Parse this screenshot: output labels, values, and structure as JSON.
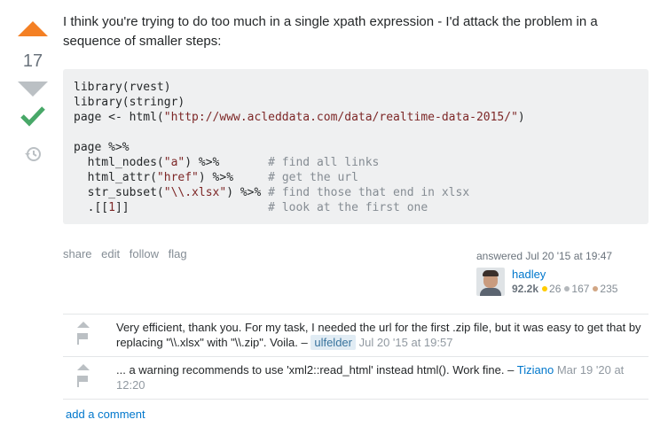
{
  "vote": {
    "score": "17",
    "accepted": true
  },
  "answer": {
    "intro": "I think you're trying to do too much in a single xpath expression - I'd attack the problem in a sequence of smaller steps:",
    "code_lines": [
      "library(rvest)",
      "library(stringr)",
      "page <- html(\"http://www.acleddata.com/data/realtime-data-2015/\")",
      "",
      "page %>%",
      "  html_nodes(\"a\") %>%       # find all links",
      "  html_attr(\"href\") %>%     # get the url",
      "  str_subset(\"\\\\.xlsx\") %>% # find those that end in xlsx",
      "  .[[1]]                    # look at the first one"
    ]
  },
  "post_menu": {
    "share": "share",
    "edit": "edit",
    "follow": "follow",
    "flag": "flag"
  },
  "signature": {
    "action": "answered Jul 20 '15 at 19:47",
    "user": "hadley",
    "reputation": "92.2k",
    "gold": "26",
    "silver": "167",
    "bronze": "235"
  },
  "comments": [
    {
      "text": "Very efficient, thank you. For my task, I needed the url for the first .zip file, but it was easy to get that by replacing \"\\\\.xlsx\" with \"\\\\.zip\". Voila. –",
      "user": "ulfelder",
      "date": "Jul 20 '15 at 19:57"
    },
    {
      "text": "... a warning recommends to use 'xml2::read_html' instead html(). Work fine. –",
      "user": "Tiziano",
      "date": "Mar 19 '20 at 12:20"
    }
  ],
  "add_comment": "add a comment",
  "colors": {
    "accent_orange": "#f48024",
    "accepted_green": "#48a868",
    "link_blue": "#0077cc"
  },
  "icons": [
    "upvote-arrow-icon",
    "downvote-arrow-icon",
    "accepted-check-icon",
    "history-icon",
    "flag-icon"
  ]
}
